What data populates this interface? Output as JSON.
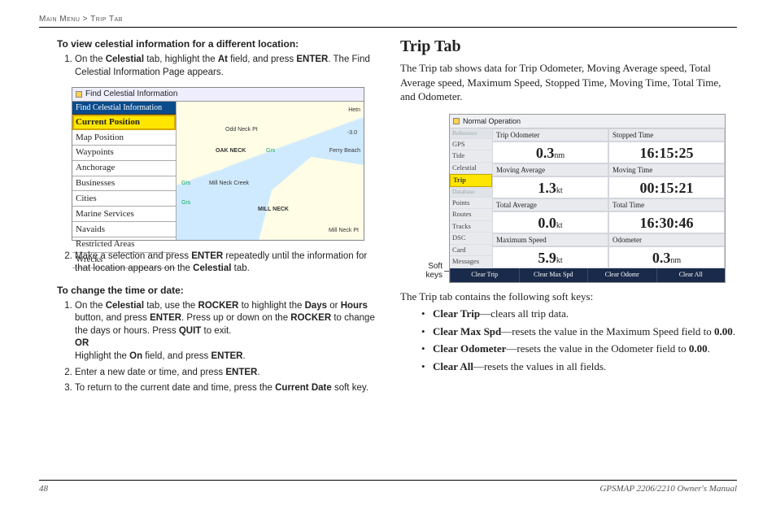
{
  "breadcrumb": {
    "main": "Main Menu",
    "sep": ">",
    "sub": "Trip Tab"
  },
  "left": {
    "head1": "To view celestial information for a different location:",
    "step1_a": "On the ",
    "step1_b": "Celestial",
    "step1_c": " tab, highlight the ",
    "step1_d": "At",
    "step1_e": " field, and press ",
    "step1_f": "ENTER",
    "step1_g": ". The Find Celestial Information Page appears.",
    "step2_a": "Make a selection and press ",
    "step2_b": "ENTER",
    "step2_c": " repeatedly until the information for that location appears on the ",
    "step2_d": "Celestial",
    "step2_e": " tab.",
    "head2": "To change the time or date:",
    "s2_1a": "On the ",
    "s2_1b": "Celestial",
    "s2_1c": " tab, use the ",
    "s2_1d": "ROCKER",
    "s2_1e": " to highlight the ",
    "s2_1f": "Days",
    "s2_1g": " or ",
    "s2_1h": "Hours",
    "s2_1i": " button, and press ",
    "s2_1j": "ENTER",
    "s2_1k": ". Press up or down on the ",
    "s2_1l": "ROCKER",
    "s2_1m": " to change the days or hours. Press ",
    "s2_1n": "QUIT",
    "s2_1o": " to exit.",
    "s2_or": "OR",
    "s2_1p": "Highlight the ",
    "s2_1q": "On",
    "s2_1r": " field, and press ",
    "s2_1s": "ENTER",
    "s2_1t": ".",
    "s2_2a": "Enter a new date or time, and press ",
    "s2_2b": "ENTER",
    "s2_2c": ".",
    "s2_3a": "To return to the current date and time, press the ",
    "s2_3b": "Current Date",
    "s2_3c": " soft key."
  },
  "fig1": {
    "title": "Find Celestial Information",
    "panel_head": "Find Celestial Information",
    "items": [
      "Current Position",
      "Map Position",
      "Waypoints",
      "Anchorage",
      "Businesses",
      "Cities",
      "Marine Services",
      "Navaids",
      "Restricted Areas",
      "Wrecks"
    ],
    "map_labels": [
      "Hetn",
      "Odd Neck Pt",
      "-3.0",
      "OAK NECK",
      "Grs",
      "Ferry Beach",
      "Grs",
      "Mill Neck Creek",
      "Grs",
      "MILL NECK",
      "Mill Neck Pt"
    ]
  },
  "right": {
    "title": "Trip Tab",
    "intro": "The Trip tab shows data for Trip Odometer, Moving Average speed, Total Average speed, Maximum Speed, Stopped Time, Moving Time, Total Time, and Odometer.",
    "soft_label": "Soft keys",
    "after": "The Trip tab contains the following soft keys:",
    "b1a": "Clear Trip",
    "b1b": "—clears all trip data.",
    "b2a": "Clear Max Spd",
    "b2b": "—resets the value in the Maximum Speed field to ",
    "b2c": "0.00",
    "b2d": ".",
    "b3a": "Clear Odometer",
    "b3b": "—resets the value in the Odometer field to ",
    "b3c": "0.00",
    "b3d": ".",
    "b4a": "Clear All",
    "b4b": "—resets the values in all fields."
  },
  "fig2": {
    "title": "Normal Operation",
    "nav_sec1": "Reference",
    "nav": [
      "GPS",
      "Tide",
      "Celestial",
      "Trip"
    ],
    "nav_sec2": "Database",
    "nav2": [
      "Points",
      "Routes",
      "Tracks",
      "DSC",
      "Card",
      "Messages"
    ],
    "headers": [
      "Trip Odometer",
      "Stopped Time",
      "Moving Average",
      "Moving Time",
      "Total Average",
      "Total Time",
      "Maximum Speed",
      "Odometer"
    ],
    "vals": [
      {
        "n": "0.3",
        "u": "nm"
      },
      {
        "n": "16:15:25",
        "u": ""
      },
      {
        "n": "1.3",
        "u": "kt"
      },
      {
        "n": "00:15:21",
        "u": ""
      },
      {
        "n": "0.0",
        "u": "kt"
      },
      {
        "n": "16:30:46",
        "u": ""
      },
      {
        "n": "5.9",
        "u": "kt"
      },
      {
        "n": "0.3",
        "u": "nm"
      }
    ],
    "soft": [
      "Clear Trip",
      "Clear Max Spd",
      "Clear Odomr",
      "Clear All"
    ]
  },
  "footer": {
    "page": "48",
    "book": "GPSMAP 2206/2210 Owner's Manual"
  }
}
